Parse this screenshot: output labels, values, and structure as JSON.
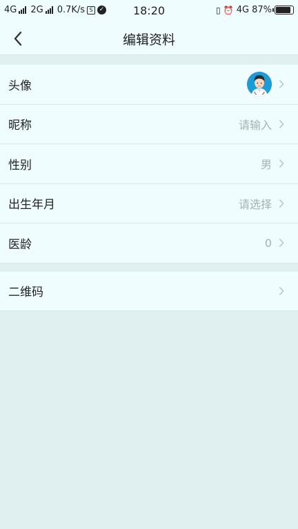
{
  "status_bar": {
    "net1": "4G",
    "net2": "2G",
    "speed": "0.7K/s",
    "time": "18:20",
    "net3": "4G",
    "battery": "87%",
    "battery_level": 0.87
  },
  "header": {
    "title": "编辑资料",
    "back_icon": "chevron-left-icon"
  },
  "rows": [
    {
      "label": "头像",
      "value": "",
      "type": "avatar"
    },
    {
      "label": "昵称",
      "value": "请输入"
    },
    {
      "label": "性别",
      "value": "男"
    },
    {
      "label": "出生年月",
      "value": "请选择"
    },
    {
      "label": "医龄",
      "value": "0"
    }
  ],
  "qr_row": {
    "label": "二维码",
    "value": ""
  },
  "colors": {
    "background": "#e0f0f0",
    "row_background": "#effdff",
    "avatar_bg": "#1e9ad6"
  }
}
